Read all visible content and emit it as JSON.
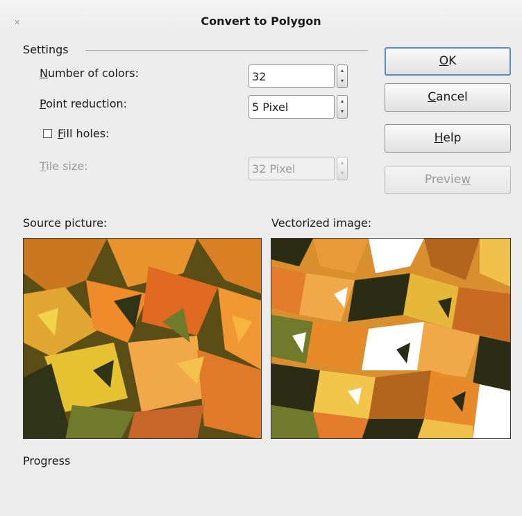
{
  "window": {
    "title": "Convert to Polygon",
    "close_glyph": "✕"
  },
  "settings": {
    "section_label": "Settings",
    "number_of_colors": {
      "label_mnemonic": "N",
      "label_rest": "umber of colors:",
      "value": "32"
    },
    "point_reduction": {
      "label_mnemonic": "P",
      "label_rest": "oint reduction:",
      "value": "5 Pixel"
    },
    "fill_holes": {
      "label_mnemonic": "F",
      "label_rest": "ill holes:",
      "checked": false
    },
    "tile_size": {
      "label_mnemonic": "T",
      "label_rest": "ile size:",
      "value": "32 Pixel",
      "enabled": false
    },
    "spin_arrow_glyphs": "⌃⌄"
  },
  "buttons": {
    "ok": {
      "mnemonic": "O",
      "rest": "K"
    },
    "cancel": {
      "mnemonic": "C",
      "rest": "ancel"
    },
    "help": {
      "mnemonic": "H",
      "rest": "elp"
    },
    "preview": {
      "before": "Previe",
      "mnemonic": "w",
      "enabled": false
    }
  },
  "pictures": {
    "source_label": "Source picture:",
    "vectorized_label": "Vectorized image:"
  },
  "progress": {
    "label": "Progress"
  },
  "colors": {
    "dialog_bg": "#ececec",
    "default_button_border": "#5b87c5",
    "leaf_orange": "#e8892a",
    "leaf_yellow": "#e6c233",
    "leaf_dark": "#2f3318",
    "leaf_green": "#6f7a2a"
  }
}
